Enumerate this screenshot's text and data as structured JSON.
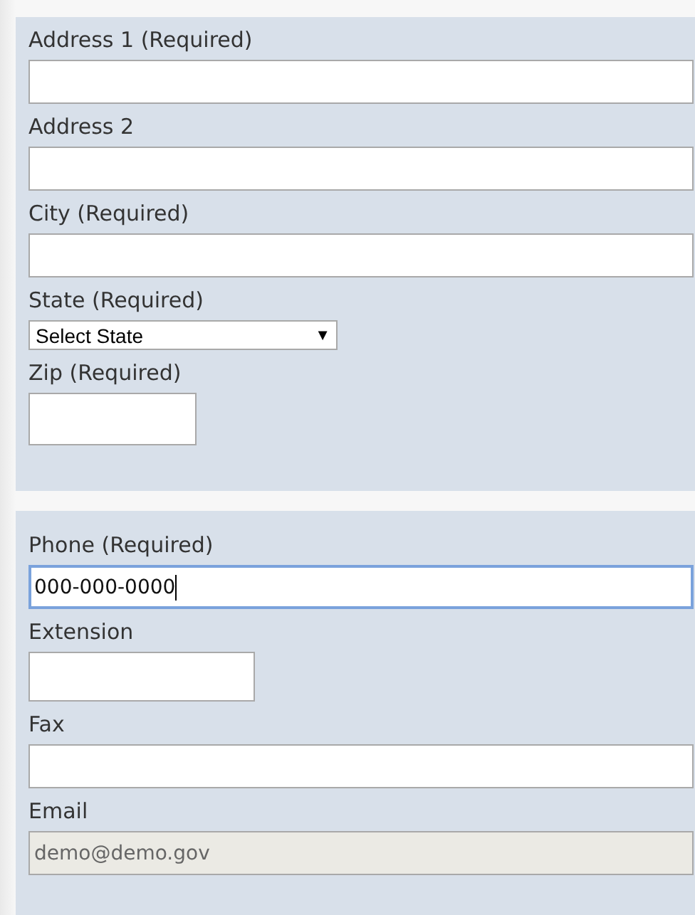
{
  "sections": [
    {
      "fields": [
        {
          "label": "Address 1 (Required)",
          "kind": "wide",
          "focused": false,
          "disabled": false
        },
        {
          "label": "Address 2",
          "kind": "wide",
          "focused": false,
          "disabled": false
        },
        {
          "label": "City (Required)",
          "kind": "wide",
          "focused": false,
          "disabled": false
        },
        {
          "label": "State (Required)",
          "kind": "dropdown",
          "value": "Select State",
          "arrow": "▼"
        },
        {
          "label": "Zip (Required)",
          "kind": "short",
          "focused": false,
          "disabled": false
        }
      ]
    },
    {
      "fields": [
        {
          "label": "Phone (Required)",
          "kind": "wide",
          "value": "000-000-0000",
          "focused": true,
          "disabled": false
        },
        {
          "label": "Extension",
          "kind": "medium",
          "focused": false,
          "disabled": false
        },
        {
          "label": "Fax",
          "kind": "wide",
          "focused": false,
          "disabled": false
        },
        {
          "label": "Email",
          "kind": "wide",
          "value": "demo@demo.gov",
          "focused": false,
          "disabled": true
        }
      ]
    }
  ]
}
